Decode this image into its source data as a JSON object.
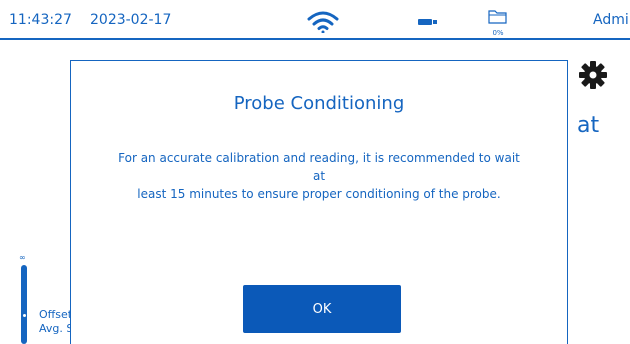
{
  "status_bar": {
    "time": "11:43:27",
    "date": "2023-02-17",
    "storage_percent": "0%",
    "user": "Admin",
    "icons": [
      "wifi-icon",
      "battery-icon",
      "folder-icon"
    ]
  },
  "background": {
    "title_fragment": "at",
    "offset_label": "Offset",
    "avg_label": "Avg. S",
    "slider_glyph": "∞",
    "icons": [
      "gear-icon"
    ]
  },
  "dialog": {
    "title": "Probe Conditioning",
    "message_line1": "For an accurate calibration and reading, it is recommended to wait at",
    "message_line2": "least 15 minutes to ensure proper conditioning of the probe.",
    "ok_label": "OK"
  },
  "colors": {
    "accent": "#1565c0",
    "button": "#0b59b8",
    "background": "#ffffff"
  }
}
